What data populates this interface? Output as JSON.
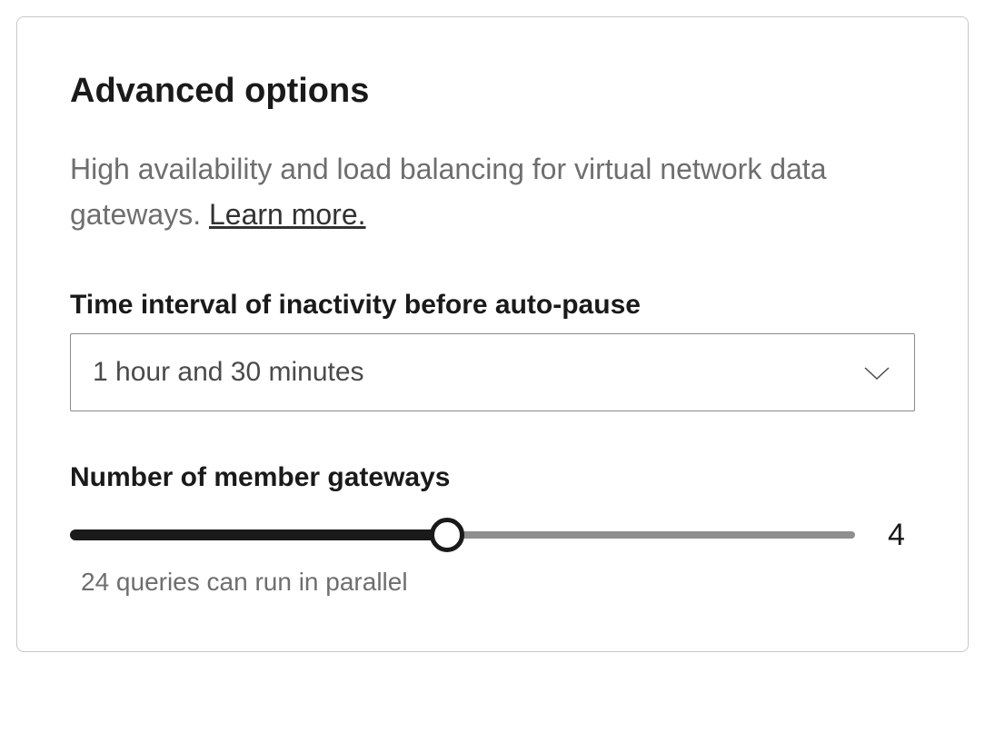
{
  "section": {
    "title": "Advanced options",
    "description_prefix": "High availability and load balancing for virtual network data gateways. ",
    "learn_more_label": "Learn more."
  },
  "time_interval": {
    "label": "Time interval of inactivity before auto-pause",
    "value": "1 hour and 30 minutes"
  },
  "member_gateways": {
    "label": "Number of member gateways",
    "value": "4",
    "helper_text": "24 queries can run in parallel",
    "slider_fill_percent": 48
  }
}
